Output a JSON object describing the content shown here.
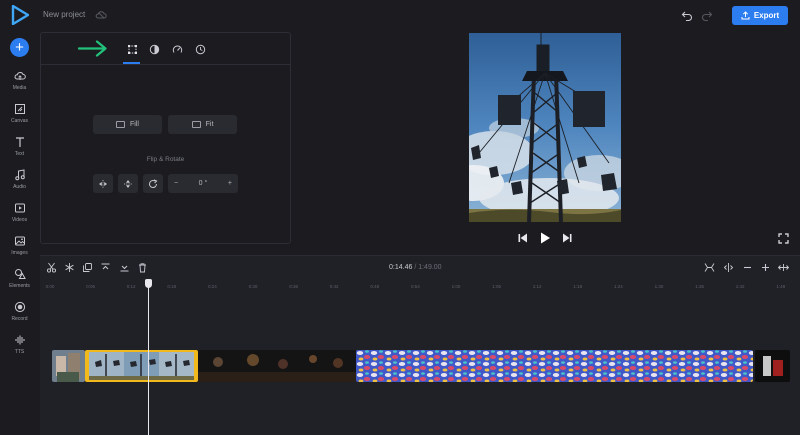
{
  "app": {
    "project_name": "New project",
    "export_label": "Export"
  },
  "sidebar": {
    "items": [
      {
        "label": "Media",
        "icon": "cloud-upload-icon"
      },
      {
        "label": "Canvas",
        "icon": "canvas-icon"
      },
      {
        "label": "Text",
        "icon": "text-icon"
      },
      {
        "label": "Audio",
        "icon": "music-note-icon"
      },
      {
        "label": "Videos",
        "icon": "video-icon"
      },
      {
        "label": "Images",
        "icon": "image-icon"
      },
      {
        "label": "Elements",
        "icon": "elements-icon"
      },
      {
        "label": "Record",
        "icon": "record-icon"
      },
      {
        "label": "TTS",
        "icon": "waveform-icon"
      }
    ]
  },
  "panel": {
    "tabs": [
      "crop-icon",
      "contrast-icon",
      "speed-icon",
      "clock-icon"
    ],
    "active_tab": 0,
    "fill_label": "Fill",
    "fit_label": "Fit",
    "flip_rotate_label": "Flip & Rotate",
    "rotation_value": "0 °",
    "minus": "−",
    "plus": "+"
  },
  "timeline": {
    "current_time": "0:14.46",
    "separator": "/",
    "total_time": "1:49.00",
    "ruler_ticks": [
      "0:00",
      "0:06",
      "0:12",
      "0:18",
      "0:24",
      "0:30",
      "0:36",
      "0:42",
      "0:48",
      "0:54",
      "1:00",
      "1:06",
      "1:12",
      "1:18",
      "1:24",
      "1:30",
      "1:36",
      "1:42",
      "1:48"
    ]
  },
  "colors": {
    "accent": "#2c7df0",
    "selection": "#f2b91c",
    "arrow": "#22c27a"
  }
}
